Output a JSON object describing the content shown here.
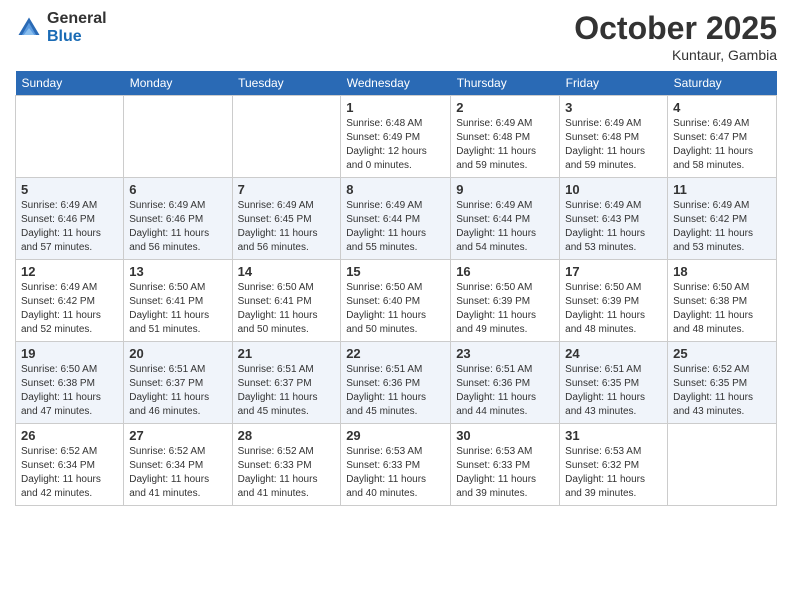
{
  "header": {
    "logo_general": "General",
    "logo_blue": "Blue",
    "month": "October 2025",
    "location": "Kuntaur, Gambia"
  },
  "weekdays": [
    "Sunday",
    "Monday",
    "Tuesday",
    "Wednesday",
    "Thursday",
    "Friday",
    "Saturday"
  ],
  "weeks": [
    [
      {
        "day": "",
        "sunrise": "",
        "sunset": "",
        "daylight": ""
      },
      {
        "day": "",
        "sunrise": "",
        "sunset": "",
        "daylight": ""
      },
      {
        "day": "",
        "sunrise": "",
        "sunset": "",
        "daylight": ""
      },
      {
        "day": "1",
        "sunrise": "Sunrise: 6:48 AM",
        "sunset": "Sunset: 6:49 PM",
        "daylight": "Daylight: 12 hours and 0 minutes."
      },
      {
        "day": "2",
        "sunrise": "Sunrise: 6:49 AM",
        "sunset": "Sunset: 6:48 PM",
        "daylight": "Daylight: 11 hours and 59 minutes."
      },
      {
        "day": "3",
        "sunrise": "Sunrise: 6:49 AM",
        "sunset": "Sunset: 6:48 PM",
        "daylight": "Daylight: 11 hours and 59 minutes."
      },
      {
        "day": "4",
        "sunrise": "Sunrise: 6:49 AM",
        "sunset": "Sunset: 6:47 PM",
        "daylight": "Daylight: 11 hours and 58 minutes."
      }
    ],
    [
      {
        "day": "5",
        "sunrise": "Sunrise: 6:49 AM",
        "sunset": "Sunset: 6:46 PM",
        "daylight": "Daylight: 11 hours and 57 minutes."
      },
      {
        "day": "6",
        "sunrise": "Sunrise: 6:49 AM",
        "sunset": "Sunset: 6:46 PM",
        "daylight": "Daylight: 11 hours and 56 minutes."
      },
      {
        "day": "7",
        "sunrise": "Sunrise: 6:49 AM",
        "sunset": "Sunset: 6:45 PM",
        "daylight": "Daylight: 11 hours and 56 minutes."
      },
      {
        "day": "8",
        "sunrise": "Sunrise: 6:49 AM",
        "sunset": "Sunset: 6:44 PM",
        "daylight": "Daylight: 11 hours and 55 minutes."
      },
      {
        "day": "9",
        "sunrise": "Sunrise: 6:49 AM",
        "sunset": "Sunset: 6:44 PM",
        "daylight": "Daylight: 11 hours and 54 minutes."
      },
      {
        "day": "10",
        "sunrise": "Sunrise: 6:49 AM",
        "sunset": "Sunset: 6:43 PM",
        "daylight": "Daylight: 11 hours and 53 minutes."
      },
      {
        "day": "11",
        "sunrise": "Sunrise: 6:49 AM",
        "sunset": "Sunset: 6:42 PM",
        "daylight": "Daylight: 11 hours and 53 minutes."
      }
    ],
    [
      {
        "day": "12",
        "sunrise": "Sunrise: 6:49 AM",
        "sunset": "Sunset: 6:42 PM",
        "daylight": "Daylight: 11 hours and 52 minutes."
      },
      {
        "day": "13",
        "sunrise": "Sunrise: 6:50 AM",
        "sunset": "Sunset: 6:41 PM",
        "daylight": "Daylight: 11 hours and 51 minutes."
      },
      {
        "day": "14",
        "sunrise": "Sunrise: 6:50 AM",
        "sunset": "Sunset: 6:41 PM",
        "daylight": "Daylight: 11 hours and 50 minutes."
      },
      {
        "day": "15",
        "sunrise": "Sunrise: 6:50 AM",
        "sunset": "Sunset: 6:40 PM",
        "daylight": "Daylight: 11 hours and 50 minutes."
      },
      {
        "day": "16",
        "sunrise": "Sunrise: 6:50 AM",
        "sunset": "Sunset: 6:39 PM",
        "daylight": "Daylight: 11 hours and 49 minutes."
      },
      {
        "day": "17",
        "sunrise": "Sunrise: 6:50 AM",
        "sunset": "Sunset: 6:39 PM",
        "daylight": "Daylight: 11 hours and 48 minutes."
      },
      {
        "day": "18",
        "sunrise": "Sunrise: 6:50 AM",
        "sunset": "Sunset: 6:38 PM",
        "daylight": "Daylight: 11 hours and 48 minutes."
      }
    ],
    [
      {
        "day": "19",
        "sunrise": "Sunrise: 6:50 AM",
        "sunset": "Sunset: 6:38 PM",
        "daylight": "Daylight: 11 hours and 47 minutes."
      },
      {
        "day": "20",
        "sunrise": "Sunrise: 6:51 AM",
        "sunset": "Sunset: 6:37 PM",
        "daylight": "Daylight: 11 hours and 46 minutes."
      },
      {
        "day": "21",
        "sunrise": "Sunrise: 6:51 AM",
        "sunset": "Sunset: 6:37 PM",
        "daylight": "Daylight: 11 hours and 45 minutes."
      },
      {
        "day": "22",
        "sunrise": "Sunrise: 6:51 AM",
        "sunset": "Sunset: 6:36 PM",
        "daylight": "Daylight: 11 hours and 45 minutes."
      },
      {
        "day": "23",
        "sunrise": "Sunrise: 6:51 AM",
        "sunset": "Sunset: 6:36 PM",
        "daylight": "Daylight: 11 hours and 44 minutes."
      },
      {
        "day": "24",
        "sunrise": "Sunrise: 6:51 AM",
        "sunset": "Sunset: 6:35 PM",
        "daylight": "Daylight: 11 hours and 43 minutes."
      },
      {
        "day": "25",
        "sunrise": "Sunrise: 6:52 AM",
        "sunset": "Sunset: 6:35 PM",
        "daylight": "Daylight: 11 hours and 43 minutes."
      }
    ],
    [
      {
        "day": "26",
        "sunrise": "Sunrise: 6:52 AM",
        "sunset": "Sunset: 6:34 PM",
        "daylight": "Daylight: 11 hours and 42 minutes."
      },
      {
        "day": "27",
        "sunrise": "Sunrise: 6:52 AM",
        "sunset": "Sunset: 6:34 PM",
        "daylight": "Daylight: 11 hours and 41 minutes."
      },
      {
        "day": "28",
        "sunrise": "Sunrise: 6:52 AM",
        "sunset": "Sunset: 6:33 PM",
        "daylight": "Daylight: 11 hours and 41 minutes."
      },
      {
        "day": "29",
        "sunrise": "Sunrise: 6:53 AM",
        "sunset": "Sunset: 6:33 PM",
        "daylight": "Daylight: 11 hours and 40 minutes."
      },
      {
        "day": "30",
        "sunrise": "Sunrise: 6:53 AM",
        "sunset": "Sunset: 6:33 PM",
        "daylight": "Daylight: 11 hours and 39 minutes."
      },
      {
        "day": "31",
        "sunrise": "Sunrise: 6:53 AM",
        "sunset": "Sunset: 6:32 PM",
        "daylight": "Daylight: 11 hours and 39 minutes."
      },
      {
        "day": "",
        "sunrise": "",
        "sunset": "",
        "daylight": ""
      }
    ]
  ]
}
